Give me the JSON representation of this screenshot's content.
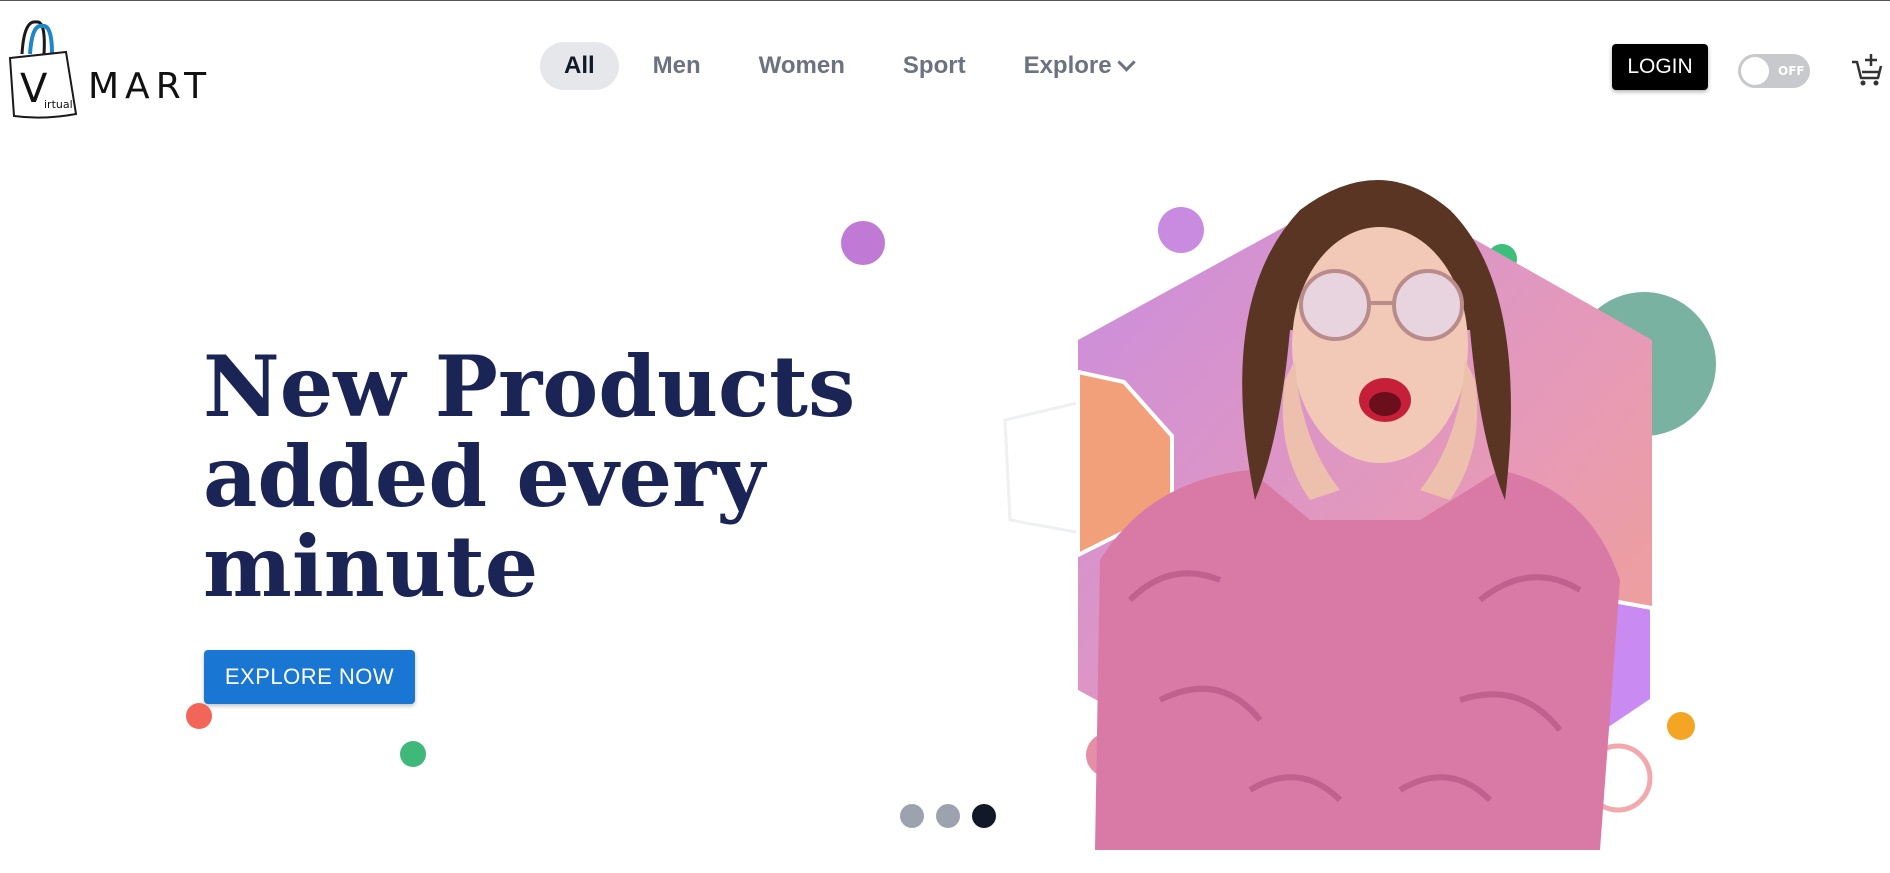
{
  "logo": {
    "letter": "V",
    "small": "irtual",
    "word": "MART"
  },
  "nav": {
    "items": [
      {
        "label": "All",
        "active": true
      },
      {
        "label": "Men",
        "active": false
      },
      {
        "label": "Women",
        "active": false
      },
      {
        "label": "Sport",
        "active": false
      }
    ],
    "explore_label": "Explore"
  },
  "header": {
    "login_label": "LOGIN",
    "toggle_text": "OFF"
  },
  "hero": {
    "line1": "New Products",
    "line2": "added every",
    "line3": "minute",
    "cta": "EXPLORE NOW"
  },
  "carousel": {
    "count": 3,
    "active_index": 2
  },
  "colors": {
    "headline": "#1a2556",
    "cta": "#1976d2",
    "nav_active_bg": "#e5e7eb"
  },
  "icons": [
    "shopping-bag-icon",
    "chevron-down-icon",
    "cart-plus-icon"
  ]
}
